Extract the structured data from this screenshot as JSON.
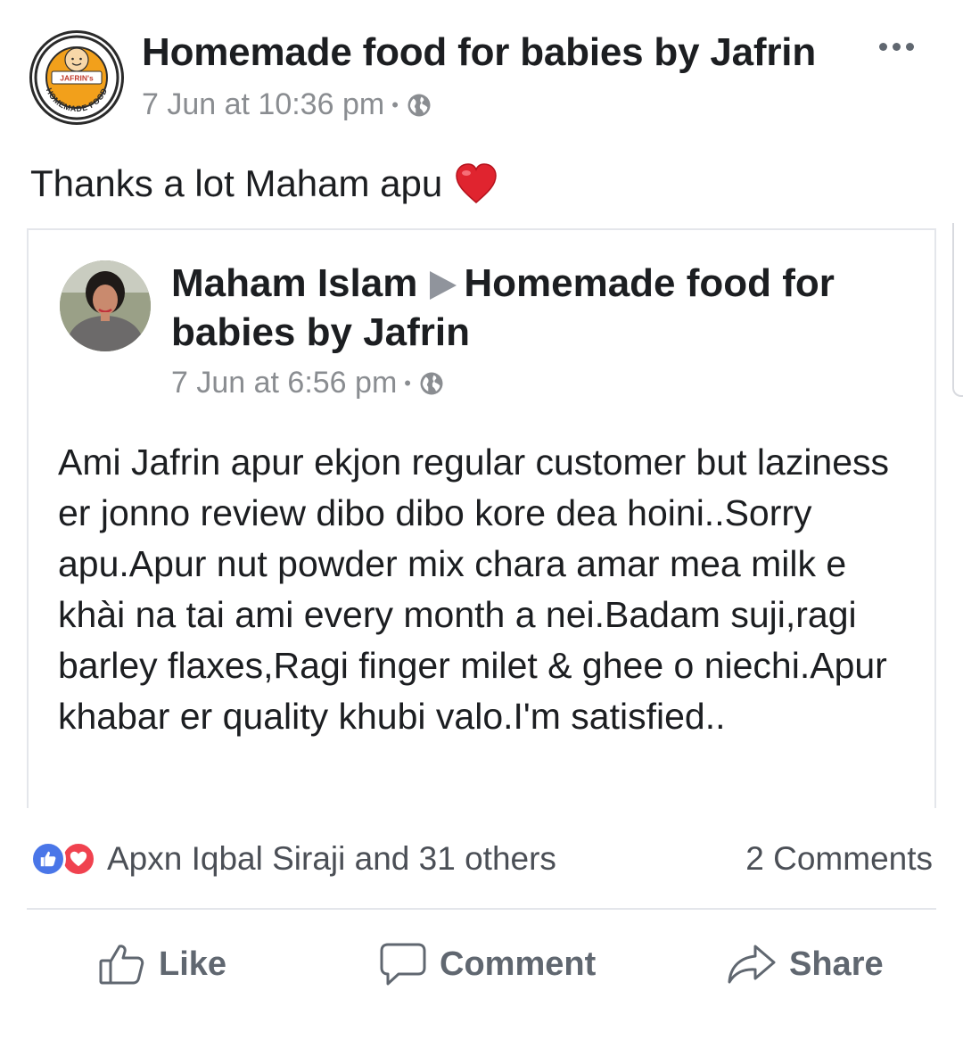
{
  "post": {
    "page_name": "Homemade food for babies by Jafrin",
    "timestamp": "7 Jun at 10:36 pm",
    "separator": "•",
    "privacy_icon": "globe-icon",
    "more_icon": "more-options-icon",
    "text": "Thanks a lot Maham apu",
    "emoji": "red-heart-emoji",
    "logo": {
      "top_text": "JAFRIN's",
      "ring_text": "HOMEMADE FOOD"
    }
  },
  "shared": {
    "author": "Maham Islam",
    "target_page": "Homemade food for babies by Jafrin",
    "timestamp": "7 Jun at 6:56 pm",
    "separator": "•",
    "body": "Ami Jafrin apur ekjon regular customer but laziness er jonno review dibo dibo kore dea hoini..Sorry apu.Apur nut powder mix chara amar mea milk e khài na tai ami every month a nei.Badam suji,ragi barley flaxes,Ragi finger milet & ghee o niechi.Apur khabar er quality khubi valo.I'm satisfied.."
  },
  "reactions": {
    "icons": [
      "like-reaction-icon",
      "love-reaction-icon"
    ],
    "summary": "Apxn Iqbal Siraji and 31 others",
    "comments": "2 Comments"
  },
  "actions": {
    "like": "Like",
    "comment": "Comment",
    "share": "Share"
  },
  "colors": {
    "text": "#1c1e21",
    "meta": "#8a8d91",
    "action": "#606770",
    "like_blue": "#4a76e8",
    "love_red": "#f0424f",
    "divider": "#e4e6eb"
  }
}
